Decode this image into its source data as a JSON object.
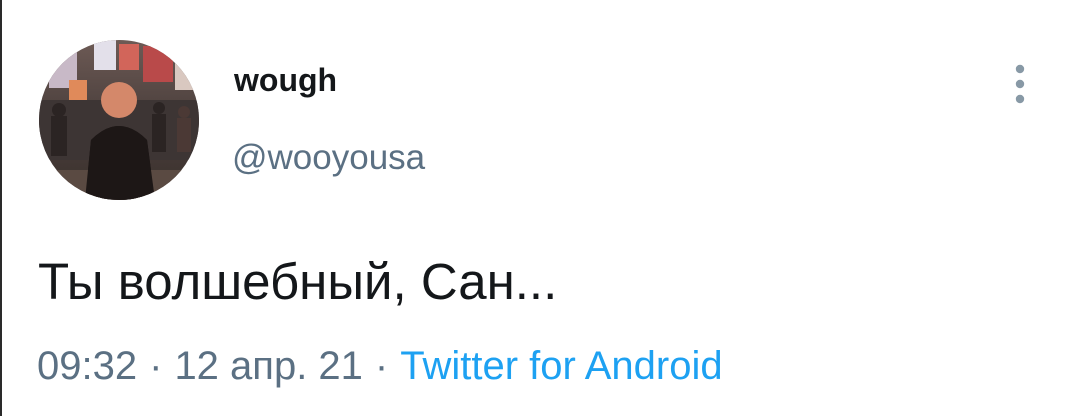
{
  "tweet": {
    "display_name": "wough",
    "handle": "@wooyousa",
    "avatar_icon": "profile-photo-street-scene",
    "more_icon": "more-vertical-icon",
    "text": "Ты волшебный, Сан...",
    "time": "09:32",
    "separator": "·",
    "date": "12 апр. 21",
    "source": "Twitter for Android"
  },
  "colors": {
    "text_primary": "#14171a",
    "text_secondary": "#5b7083",
    "link": "#1da1f2",
    "icon_gray": "#8899a6"
  }
}
